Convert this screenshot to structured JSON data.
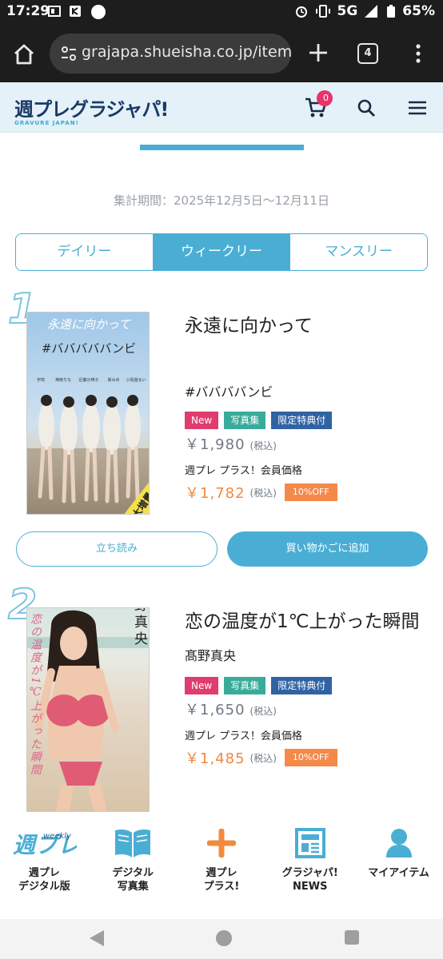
{
  "status_bar": {
    "time": "17:29",
    "network": "5G",
    "battery": "65%"
  },
  "browser": {
    "url": "grajapa.shueisha.co.jp/item",
    "tab_count": "4"
  },
  "site": {
    "logo_text": "週プレグラジャパ!",
    "logo_sub": "GRAVURE JAPAN!",
    "cart_count": "0"
  },
  "ranking": {
    "period": "集計期間：2025年12月5日〜12月11日",
    "tabs": [
      {
        "label": "デイリー",
        "active": false
      },
      {
        "label": "ウィークリー",
        "active": true
      },
      {
        "label": "マンスリー",
        "active": false
      }
    ]
  },
  "items": [
    {
      "rank": "1",
      "title": "永遠に向かって",
      "author": "#ババババンビ",
      "badges": [
        "New",
        "写真集",
        "限定特典付"
      ],
      "price": "￥1,980",
      "tax_label": "(税込)",
      "member_label": "週プレ プラス！会員価格",
      "member_price": "￥1,782",
      "member_tax_label": "(税込)",
      "discount": "10%OFF",
      "cover_title": "永遠に向かって",
      "cover_group": "#バババババンビ",
      "cover_names": [
        "宇咲",
        "神南りな",
        "近藤沙瑛子",
        "岸みゆ",
        "小鳥遊るい"
      ],
      "cover_stamp": "大増量",
      "read_button": "立ち読み",
      "cart_button": "買い物かごに追加"
    },
    {
      "rank": "2",
      "title": "恋の温度が1℃上がった瞬間",
      "author": "髙野真央",
      "badges": [
        "New",
        "写真集",
        "限定特典付"
      ],
      "price": "￥1,650",
      "tax_label": "(税込)",
      "member_label": "週プレ プラス！会員価格",
      "member_price": "￥1,485",
      "member_tax_label": "(税込)",
      "discount": "10%OFF",
      "cover_name": "髙野真央",
      "cover_script": "恋の温度が1℃上がった瞬間"
    }
  ],
  "bottom_nav": [
    {
      "label": "週プレ\nデジタル版",
      "icon": "weekly-logo-icon",
      "logo_text": "週プレ",
      "logo_sub": "weekly"
    },
    {
      "label": "デジタル\n写真集",
      "icon": "open-book-icon"
    },
    {
      "label": "週プレ\nプラス!",
      "icon": "plus-icon"
    },
    {
      "label": "グラジャパ!\nNEWS",
      "icon": "newspaper-icon"
    },
    {
      "label": "マイアイテム",
      "icon": "user-icon"
    }
  ],
  "colors": {
    "accent": "#4aaed4",
    "new": "#e13c6e",
    "photo": "#3aab9a",
    "limited": "#2f63a3",
    "member_price": "#f1883c"
  }
}
